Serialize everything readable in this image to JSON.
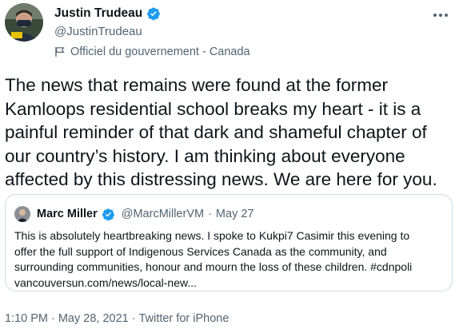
{
  "author": {
    "name": "Justin Trudeau",
    "handle": "@JustinTrudeau",
    "label": "Officiel du gouvernement - Canada"
  },
  "tweet": {
    "text": "The news that remains were found at the former Kamloops residential school breaks my heart - it is a painful reminder of that dark and shameful chapter of our country’s history. I am thinking about everyone affected by this distressing news. We are here for you."
  },
  "quoted": {
    "name": "Marc Miller",
    "handle": "@MarcMillerVM",
    "separator": "·",
    "date": "May 27",
    "lines": [
      "This is absolutely heartbreaking news. I spoke to Kukpi7 Casimir this evening to",
      "offer the full support of Indigenous Services Canada as the community, and",
      "surrounding communities, honour and mourn the loss of these children. #cdnpoli",
      "vancouversun.com/news/local-new..."
    ]
  },
  "footer": {
    "time": "1:10 PM",
    "sep": "·",
    "date": "May 28, 2021",
    "source": "Twitter for iPhone"
  },
  "colors": {
    "text": "#0f1419",
    "muted": "#536471",
    "verified": "#1d9bf0",
    "border": "#cfd9de"
  },
  "icons": {
    "verified": "verified-badge-icon",
    "label": "flag-icon",
    "more": "more-horizontal-icon"
  }
}
